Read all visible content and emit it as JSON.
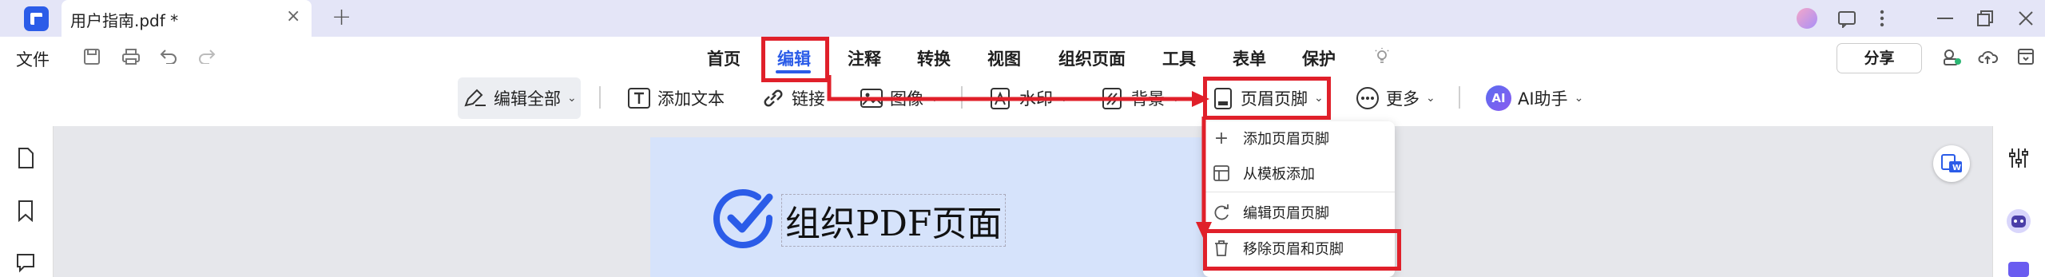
{
  "titlebar": {
    "doc_title": "用户指南.pdf *",
    "close_glyph": "×",
    "new_tab_glyph": "+",
    "icons": [
      "avatar",
      "feedback-icon",
      "more-vertical-icon",
      "minimize-icon",
      "restore-icon",
      "close-window-icon"
    ]
  },
  "menubar": {
    "file_label": "文件",
    "nav": [
      "首页",
      "编辑",
      "注释",
      "转换",
      "视图",
      "组织页面",
      "工具",
      "表单",
      "保护"
    ],
    "active_nav": "编辑",
    "share_label": "分享"
  },
  "toolbar": {
    "edit_all": "编辑全部",
    "add_text": "添加文本",
    "link": "链接",
    "image": "图像",
    "watermark": "水印",
    "background": "背景",
    "header_footer": "页眉页脚",
    "more": "更多",
    "ai_badge": "AI",
    "ai_assistant": "AI助手"
  },
  "dropdown": {
    "items": [
      "添加页眉页脚",
      "从模板添加",
      "编辑页眉页脚",
      "移除页眉和页脚"
    ]
  },
  "page": {
    "title": "组织PDF页面"
  },
  "colors": {
    "accent": "#2b5ce8",
    "annotation_red": "#e0202a",
    "page_header_bg": "#d6e3fb"
  }
}
